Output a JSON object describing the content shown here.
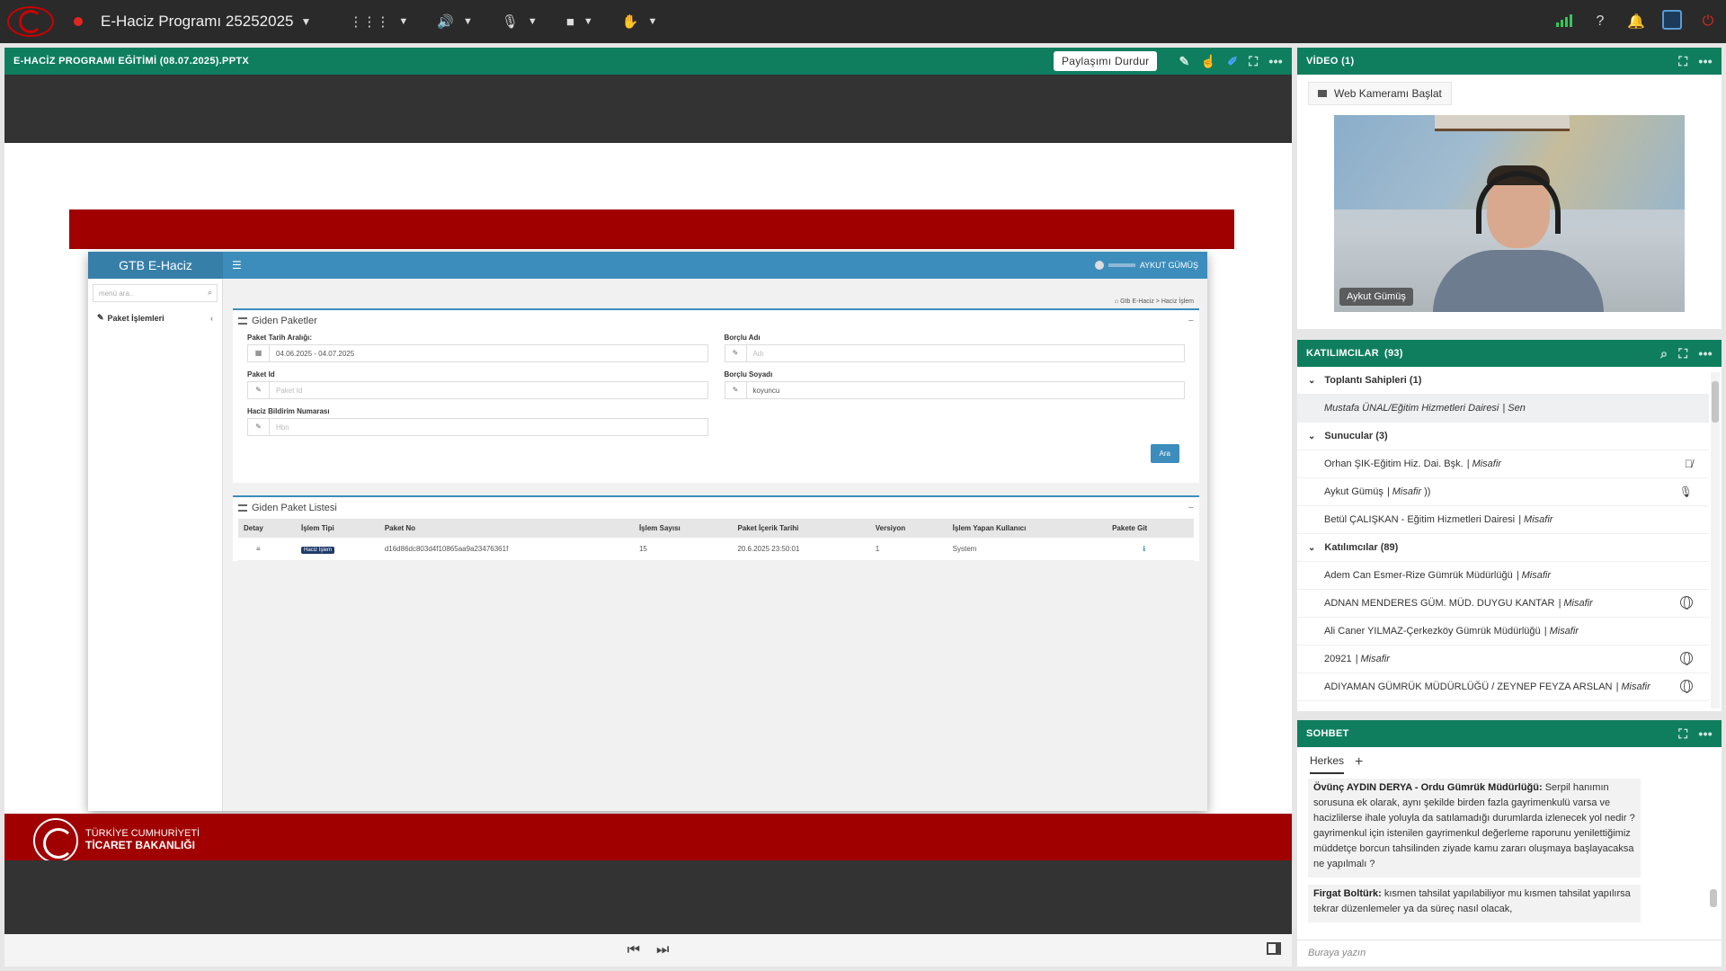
{
  "topbar": {
    "meeting_title": "E-Haciz Programı 25252025"
  },
  "share_pod": {
    "title": "E-HACİZ PROGRAMI EĞİTİMİ (08.07.2025).PPTX",
    "stop_share_label": "Paylaşımı Durdur"
  },
  "slide": {
    "ministry_line1": "TÜRKİYE CUMHURİYETİ",
    "ministry_line2": "TİCARET BAKANLIĞI",
    "app": {
      "brand": "GTB E-Haciz",
      "user_name": "AYKUT GÜMÜŞ",
      "menu_search_placeholder": "menü ara..",
      "menu_item": "Paket İşlemleri",
      "breadcrumb_home": "Gtb E-Haciz",
      "breadcrumb_current": "Haciz İşlem",
      "section1_title": "Giden Paketler",
      "form": {
        "date_range_label": "Paket Tarih Aralığı:",
        "date_range_value": "04.06.2025 - 04.07.2025",
        "debtor_name_label": "Borçlu Adı",
        "debtor_name_placeholder": "Adı",
        "package_id_label": "Paket Id",
        "package_id_placeholder": "Paket Id",
        "debtor_surname_label": "Borçlu Soyadı",
        "debtor_surname_value": "koyuncu",
        "notice_no_label": "Haciz Bildirim Numarası",
        "notice_no_placeholder": "Hbn"
      },
      "search_button": "Ara",
      "section2_title": "Giden Paket Listesi",
      "table": {
        "headers": [
          "Detay",
          "İşlem Tipi",
          "Paket No",
          "İşlem Sayısı",
          "Paket İçerik Tarihi",
          "Versiyon",
          "İşlem Yapan Kullanıcı",
          "Pakete Git"
        ],
        "rows": [
          {
            "type": "Haciz İşlem",
            "package_no": "d16d86dc803d4f10865aa9a23476361f",
            "count": "15",
            "date": "20.6.2025 23:50:01",
            "version": "1",
            "user": "System"
          }
        ]
      }
    }
  },
  "video_pod": {
    "title": "VİDEO (1)",
    "start_cam_label": "Web Kameramı Başlat",
    "name_tag": "Aykut Gümüş"
  },
  "participants_pod": {
    "title": "KATILIMCILAR",
    "count": "(93)",
    "groups": [
      {
        "label": "Toplantı Sahipleri (1)",
        "rows": [
          {
            "name": "Mustafa ÜNAL/Eğitim Hizmetleri Dairesi",
            "role": "| Sen"
          }
        ]
      },
      {
        "label": "Sunucular (3)",
        "rows": [
          {
            "name": "Orhan ŞIK-Eğitim Hiz. Dai. Bşk.",
            "role": "| Misafir"
          },
          {
            "name": "Aykut Gümüş",
            "role": "| Misafir"
          },
          {
            "name": "Betül ÇALIŞKAN - Eğitim Hizmetleri Dairesi",
            "role": "| Misafir"
          }
        ]
      },
      {
        "label": "Katılımcılar (89)",
        "rows": [
          {
            "name": "Adem Can Esmer-Rize Gümrük Müdürlüğü",
            "role": "| Misafir"
          },
          {
            "name": "ADNAN MENDERES GÜM. MÜD. DUYGU KANTAR",
            "role": "| Misafir"
          },
          {
            "name": "Ali Caner YILMAZ-Çerkezköy Gümrük Müdürlüğü",
            "role": "| Misafir"
          },
          {
            "name": "20921",
            "role": "| Misafir"
          },
          {
            "name": "ADIYAMAN GÜMRÜK MÜDÜRLÜĞÜ / ZEYNEP FEYZA ARSLAN",
            "role": "| Misafir"
          }
        ]
      }
    ]
  },
  "chat_pod": {
    "title": "SOHBET",
    "tab_everyone": "Herkes",
    "messages": [
      {
        "author": "Övünç AYDIN DERYA - Ordu Gümrük Müdürlüğü:",
        "text": "Serpil hanımın sorusuna ek olarak, aynı şekilde birden fazla gayrimenkulü varsa ve hacizlilerse ihale yoluyla da satılamadığı durumlarda izlenecek yol nedir ? gayrimenkul için istenilen gayrimenkul değerleme raporunu yenilettiğimiz müddetçe borcun tahsilinden ziyade kamu zararı oluşmaya başlayacaksa ne yapılmalı ?"
      },
      {
        "author": "Firgat Boltürk:",
        "text": "kısmen tahsilat yapılabiliyor mu kısmen tahsilat yapılırsa tekrar düzenlemeler ya da süreç nasıl olacak,"
      }
    ],
    "input_placeholder": "Buraya yazın"
  }
}
